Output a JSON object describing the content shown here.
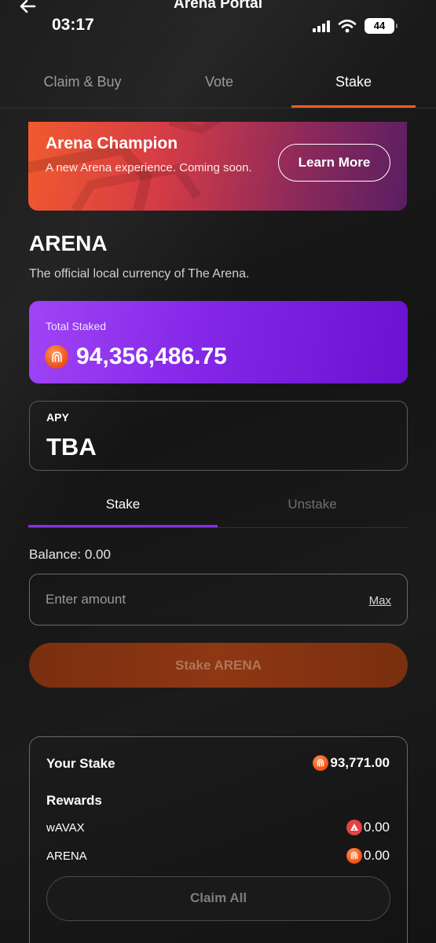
{
  "nav": {
    "title": "Arena Portal",
    "back_icon": "arrow-left-icon"
  },
  "status_bar": {
    "time": "03:17",
    "battery": "44",
    "icons": [
      "signal-icon",
      "wifi-icon",
      "battery-icon"
    ]
  },
  "tabs": [
    {
      "label": "Claim & Buy",
      "active": false
    },
    {
      "label": "Vote",
      "active": false
    },
    {
      "label": "Stake",
      "active": true
    }
  ],
  "banner": {
    "title": "Arena Champion",
    "subtitle": "A new Arena experience. Coming soon.",
    "button": "Learn More"
  },
  "token": {
    "name": "ARENA",
    "description": "The official local currency of The Arena."
  },
  "total_staked": {
    "label": "Total Staked",
    "value": "94,356,486.75"
  },
  "apy": {
    "label": "APY",
    "value": "TBA"
  },
  "stake_tabs": [
    {
      "label": "Stake",
      "active": true
    },
    {
      "label": "Unstake",
      "active": false
    }
  ],
  "balance": "Balance: 0.00",
  "amount_input": {
    "placeholder": "Enter amount",
    "value": "",
    "max_label": "Max"
  },
  "stake_button": "Stake ARENA",
  "your_stake": {
    "label": "Your Stake",
    "value": "93,771.00",
    "rewards_label": "Rewards",
    "rewards": [
      {
        "token": "wAVAX",
        "value": "0.00",
        "icon": "avax-icon"
      },
      {
        "token": "ARENA",
        "value": "0.00",
        "icon": "arena-coin-icon"
      }
    ],
    "claim_button": "Claim All"
  },
  "colors": {
    "accent_orange": "#ff5a1f",
    "accent_purple": "#8b2fe9",
    "avax_red": "#e84142"
  }
}
